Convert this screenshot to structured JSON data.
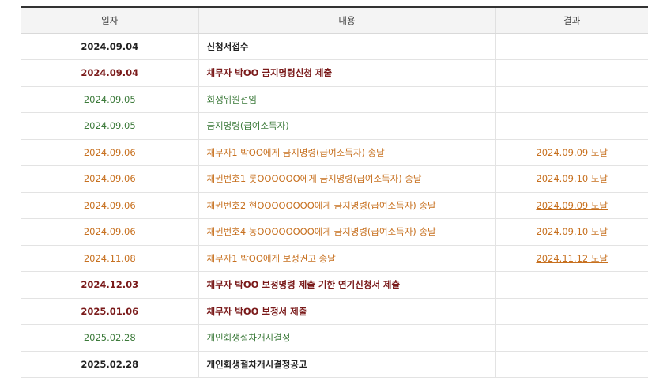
{
  "table": {
    "headers": [
      "일자",
      "내용",
      "결과"
    ],
    "rows": [
      {
        "date": "2024.09.04",
        "content": "신청서접수",
        "result": "",
        "color": "black"
      },
      {
        "date": "2024.09.04",
        "content": "채무자 박OO 금지명령신청 제출",
        "result": "",
        "color": "darkred"
      },
      {
        "date": "2024.09.05",
        "content": "회생위원선임",
        "result": "",
        "color": "green"
      },
      {
        "date": "2024.09.05",
        "content": "금지명령(급여소득자)",
        "result": "",
        "color": "green"
      },
      {
        "date": "2024.09.06",
        "content": "채무자1 박OO에게 금지명령(급여소득자) 송달",
        "result": "2024.09.09 도달",
        "color": "orange"
      },
      {
        "date": "2024.09.06",
        "content": "채권번호1 롯OOOOOO에게 금지명령(급여소득자) 송달",
        "result": "2024.09.10 도달",
        "color": "orange"
      },
      {
        "date": "2024.09.06",
        "content": "채권번호2 현OOOOOOOO에게 금지명령(급여소득자) 송달",
        "result": "2024.09.09 도달",
        "color": "orange"
      },
      {
        "date": "2024.09.06",
        "content": "채권번호4 농OOOOOOOO에게 금지명령(급여소득자) 송달",
        "result": "2024.09.10 도달",
        "color": "orange"
      },
      {
        "date": "2024.11.08",
        "content": "채무자1 박OO에게 보정권고 송달",
        "result": "2024.11.12 도달",
        "color": "orange"
      },
      {
        "date": "2024.12.03",
        "content": "채무자 박OO 보정명령 제출 기한 연기신청서 제출",
        "result": "",
        "color": "darkred"
      },
      {
        "date": "2025.01.06",
        "content": "채무자 박OO 보정서 제출",
        "result": "",
        "color": "darkred"
      },
      {
        "date": "2025.02.28",
        "content": "개인회생절차개시결정",
        "result": "",
        "color": "green"
      },
      {
        "date": "2025.02.28",
        "content": "개인회생절차개시결정공고",
        "result": "",
        "color": "black"
      }
    ]
  },
  "colors": {
    "black": "#222222",
    "darkred": "#7a1a1a",
    "green": "#3c7a3a",
    "orange": "#c7701f"
  }
}
